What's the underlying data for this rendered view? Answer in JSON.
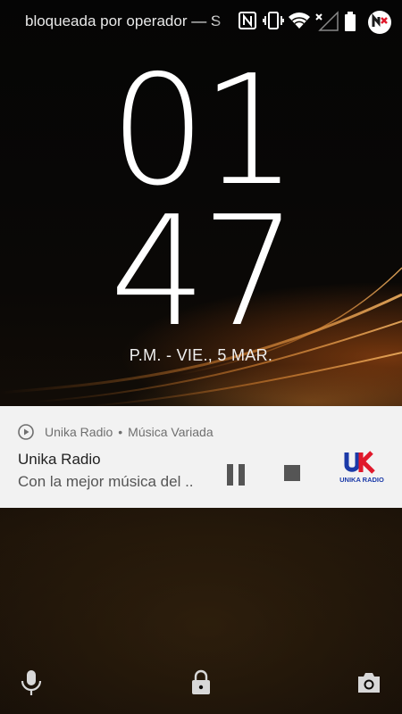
{
  "status_bar": {
    "carrier_text": "bloqueada por operador — S",
    "icons": [
      "nfc-icon",
      "vibrate-icon",
      "wifi-icon",
      "no-signal-icon",
      "battery-icon",
      "app-notification-icon"
    ]
  },
  "clock": {
    "hour": "01",
    "minute": "47",
    "date": "P.M.  -  VIE., 5 MAR."
  },
  "notification": {
    "app_name": "Unika Radio",
    "separator": "•",
    "subtitle": "Música Variada",
    "title": "Unika Radio",
    "text": "Con la mejor música del ..",
    "logo_text": "UNIKA RADIO",
    "logo_letters": "UK",
    "colors": {
      "logo_blue": "#1b3aa8",
      "logo_red": "#e0192b"
    }
  },
  "bottom_shortcuts": [
    "microphone-icon",
    "lock-icon",
    "camera-icon"
  ]
}
